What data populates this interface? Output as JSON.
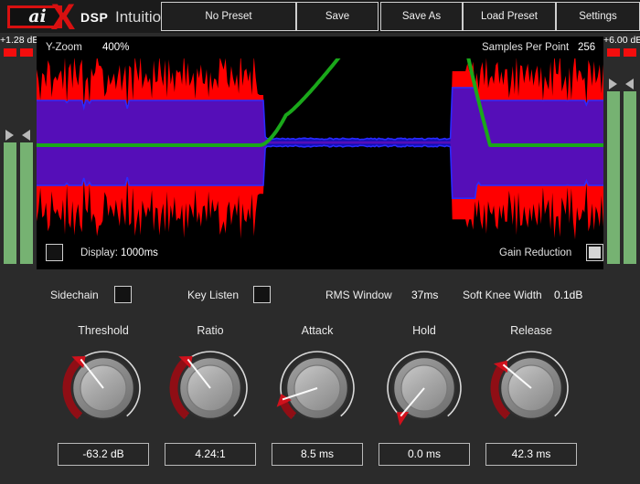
{
  "header": {
    "brand_ai": "ai",
    "brand_x": "X",
    "brand_dsp": "DSP",
    "product_name": "Intuition",
    "buttons": [
      {
        "label": "No Preset",
        "name": "preset-button"
      },
      {
        "label": "Save",
        "name": "save-button"
      },
      {
        "label": "Save As",
        "name": "save-as-button"
      },
      {
        "label": "Load Preset",
        "name": "load-preset-button"
      },
      {
        "label": "Settings",
        "name": "settings-button"
      }
    ]
  },
  "meters": {
    "input": {
      "db_label": "+1.28 dB",
      "bar_a_pct": 100,
      "bar_b_pct": 100
    },
    "output": {
      "db_label": "+6.00 dB",
      "bar_a_pct": 100,
      "bar_b_pct": 100
    }
  },
  "scope": {
    "y_zoom_label": "Y-Zoom",
    "y_zoom_value": "400%",
    "samples_label": "Samples Per Point",
    "samples_value": "256",
    "display_label": "Display:",
    "display_value": "1000ms",
    "gain_reduction_label": "Gain Reduction",
    "gain_reduction_checked": true,
    "display_checked": false,
    "colors": {
      "input_wave": "#ff0000",
      "output_wave": "#1414ff",
      "overlap": "#9b1a9b",
      "gain_curve": "#1aa81a",
      "background": "#000000"
    }
  },
  "controls": {
    "sidechain_label": "Sidechain",
    "sidechain_checked": false,
    "key_listen_label": "Key Listen",
    "key_listen_checked": false,
    "rms_window_label": "RMS Window",
    "rms_window_value": "37ms",
    "soft_knee_label": "Soft Knee Width",
    "soft_knee_value": "0.1dB"
  },
  "knobs": [
    {
      "title": "Threshold",
      "value": "-63.2 dB",
      "angle": -38,
      "arc_from": -140,
      "arc_to": -38
    },
    {
      "title": "Ratio",
      "value": "4.24:1",
      "angle": -38,
      "arc_from": -140,
      "arc_to": -38
    },
    {
      "title": "Attack",
      "value": "8.5 ms",
      "angle": -108,
      "arc_from": -140,
      "arc_to": -108
    },
    {
      "title": "Hold",
      "value": "0.0 ms",
      "angle": -140,
      "arc_from": -140,
      "arc_to": -140
    },
    {
      "title": "Release",
      "value": "42.3 ms",
      "angle": -50,
      "arc_from": -140,
      "arc_to": -50
    }
  ],
  "theme": {
    "accent_red": "#d81010",
    "panel_bg": "#2b2b2b",
    "header_bg": "#1b1b1b",
    "meter_green": "#76b272"
  }
}
